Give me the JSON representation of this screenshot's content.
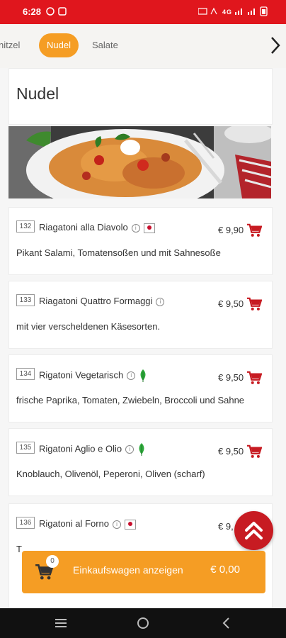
{
  "status_bar": {
    "time": "6:28",
    "network": "4G"
  },
  "categories": {
    "items": [
      "nitzel",
      "Nudel",
      "Salate"
    ],
    "active": "Nudel"
  },
  "section": {
    "title": "Nudel"
  },
  "dishes": [
    {
      "number": "132",
      "name": "Riagatoni alla Diavolo",
      "price": "€ 9,90",
      "description": "Pikant Salami, Tomatensoßen und mit Sahnesoße",
      "marker": "flag"
    },
    {
      "number": "133",
      "name": "Riagatoni Quattro Formaggi",
      "price": "€ 9,50",
      "description": "mit vier verscheldenen Käsesorten.",
      "marker": ""
    },
    {
      "number": "134",
      "name": "Rigatoni Vegetarisch",
      "price": "€ 9,50",
      "description": "frische Paprika, Tomaten, Zwiebeln, Broccoli und Sahne",
      "marker": "leaf"
    },
    {
      "number": "135",
      "name": "Rigatoni Aglio e Olio",
      "price": "€ 9,50",
      "description": "Knoblauch, Olivenöl, Peperoni, Oliven (scharf)",
      "marker": "leaf"
    },
    {
      "number": "136",
      "name": "Rigatoni al Forno",
      "price": "€ 9,",
      "description": "T",
      "marker": "flag"
    }
  ],
  "cart": {
    "count": "0",
    "label": "Einkaufswagen anzeigen",
    "total": "€ 0,00"
  },
  "icons": {
    "info": "info-circle-icon",
    "cart": "shopping-cart-icon",
    "flag": "japan-flag-icon",
    "leaf": "vegetarian-leaf-icon",
    "scroll_top": "double-chevron-up-icon"
  },
  "colors": {
    "status_bar": "#e0161d",
    "accent": "#f59d24",
    "cart_icon": "#c71b22",
    "fab": "#c71b22"
  }
}
